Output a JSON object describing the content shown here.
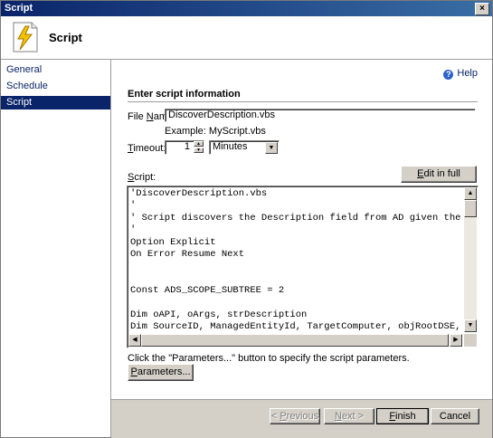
{
  "window": {
    "title": "Script",
    "close_glyph": "×"
  },
  "header": {
    "title": "Script",
    "icon": "script-lightning-icon"
  },
  "nav": {
    "items": [
      {
        "label": "General"
      },
      {
        "label": "Schedule"
      },
      {
        "label": "Script"
      }
    ],
    "selected": "Script"
  },
  "help": {
    "label": "Help",
    "icon_glyph": "?"
  },
  "section": {
    "title": "Enter script information"
  },
  "file_name": {
    "label_prefix": "File ",
    "label_underlined": "N",
    "label_suffix": "ame:",
    "value": "DiscoverDescription.vbs",
    "example": "Example:  MyScript.vbs"
  },
  "timeout": {
    "label_underlined": "T",
    "label_suffix": "imeout:",
    "value": "1",
    "unit": "Minutes"
  },
  "script": {
    "label_underlined": "S",
    "label_suffix": "cript:",
    "edit_button": {
      "underlined": "E",
      "rest": "dit in full screen..."
    },
    "code": "'DiscoverDescription.vbs\n'\n' Script discovers the Description field from AD given the DNS\n'\nOption Explicit\nOn Error Resume Next\n\n\nConst ADS_SCOPE_SUBTREE = 2\n\nDim oAPI, oArgs, strDescription\nDim SourceID, ManagedEntityId, TargetComputer, objRootDSE, strD\nDim wshnetwork, strCompName\nDim objConnection, objCommand, objRecordSet, objComputer, strCo"
  },
  "parameters": {
    "hint": "Click the \"Parameters...\" button to specify the script parameters.",
    "button": {
      "underlined": "P",
      "rest": "arameters..."
    }
  },
  "footer": {
    "previous": {
      "prefix": "< ",
      "underlined": "P",
      "rest": "revious"
    },
    "next": {
      "underlined": "N",
      "rest": "ext >"
    },
    "finish": {
      "underlined": "F",
      "rest": "inish"
    },
    "cancel": {
      "label": "Cancel"
    }
  },
  "colors": {
    "title_bar": "#0a246a",
    "nav_selected": "#0a246a",
    "link": "#0a246a",
    "dialog_face": "#d4d0c8"
  }
}
